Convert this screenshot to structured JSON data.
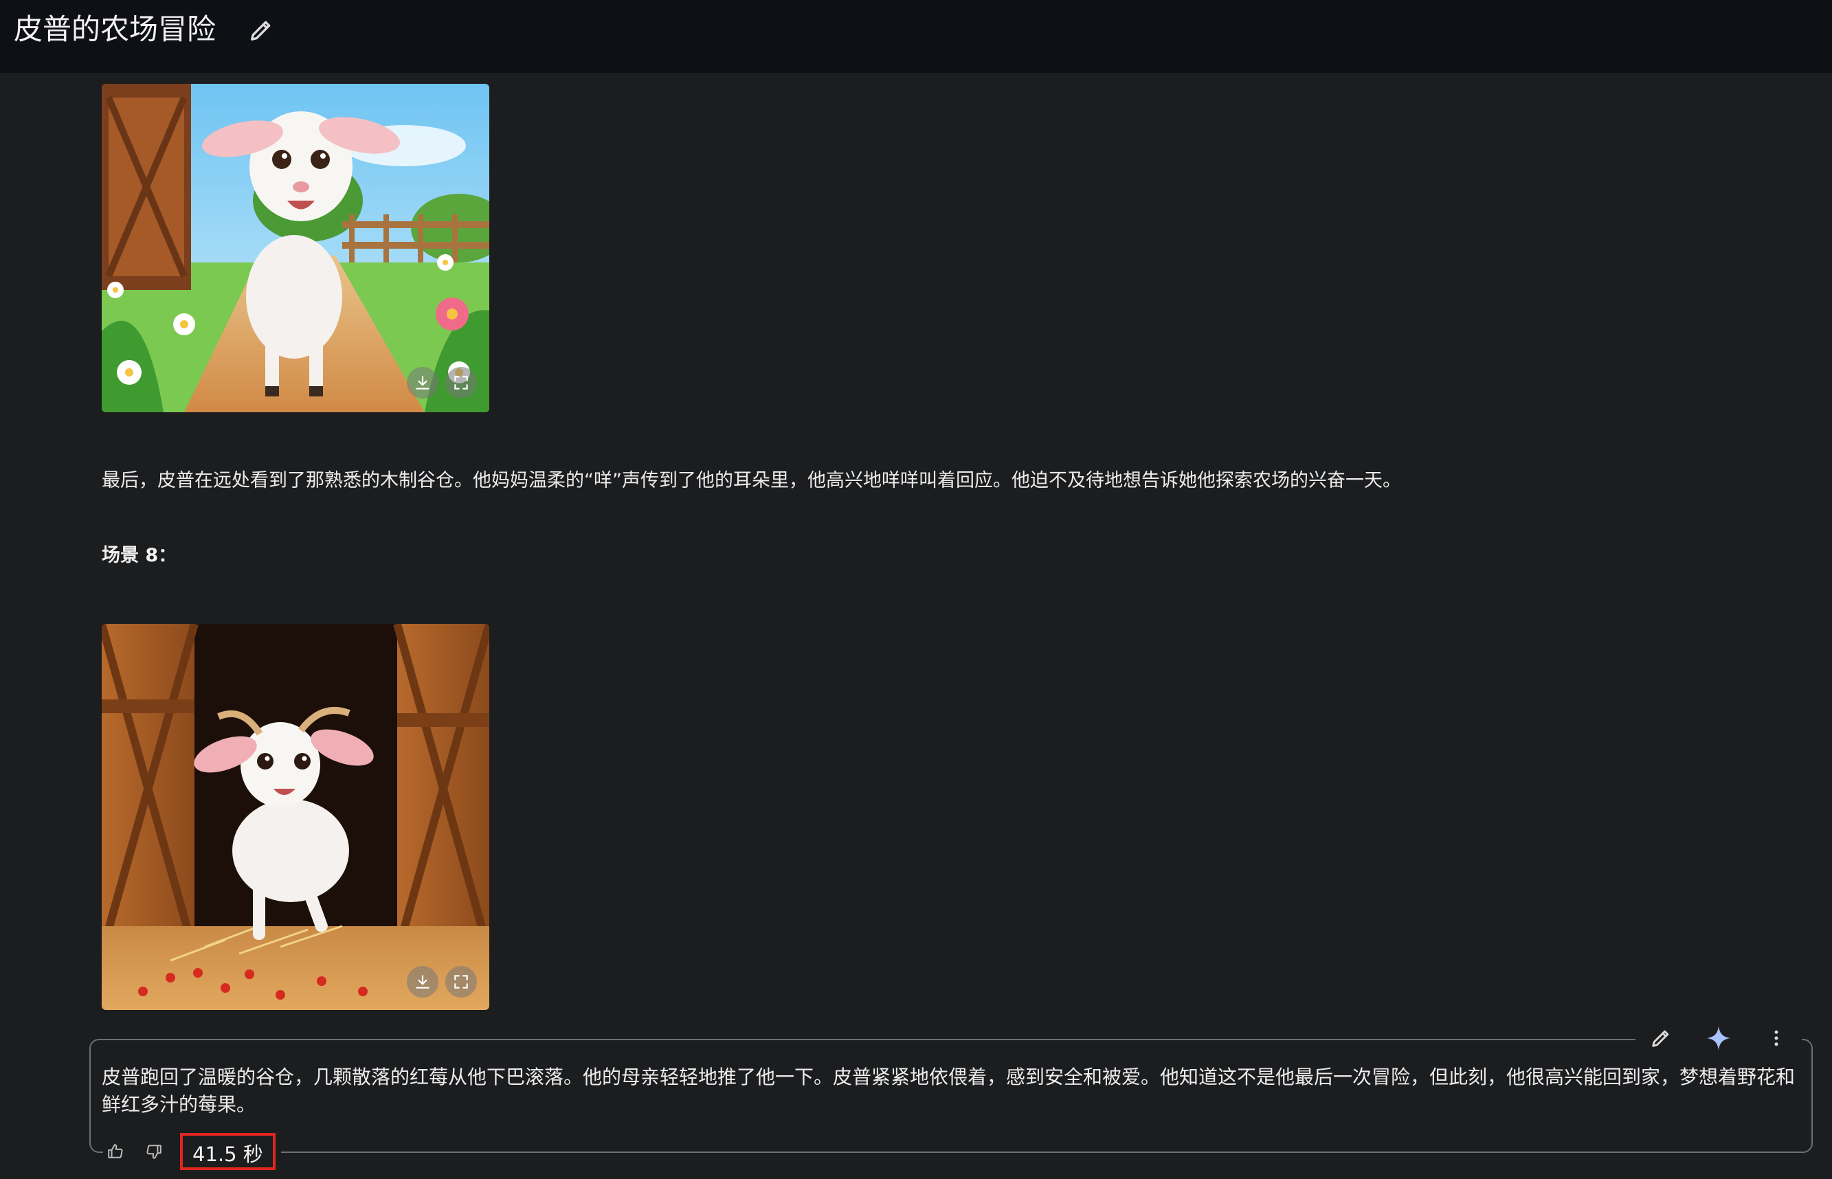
{
  "header": {
    "title": "皮普的农场冒险"
  },
  "content": {
    "image1": {
      "alt": ""
    },
    "paragraph1": "最后，皮普在远处看到了那熟悉的木制谷仓。他妈妈温柔的“咩”声传到了他的耳朵里，他高兴地咩咩叫着回应。他迫不及待地想告诉她他探索农场的兴奋一天。",
    "scene_heading": "场景 8：",
    "paragraph2": "皮普跑回了温暖的谷仓，几颗散落的红莓从他下巴滚落。他的母亲轻轻地推了他一下。皮普紧紧地依偎着，感到安全和被爱。他知道这不是他最后一次冒险，但此刻，他很高兴能回到家，梦想着野花和鲜红多汁的莓果。"
  },
  "response": {
    "elapsed": "41.5 秒"
  },
  "icons": {
    "edit": "pencil-icon",
    "sparkle": "sparkle-icon",
    "more": "more-vertical-icon",
    "download": "download-icon",
    "fullscreen": "fullscreen-icon",
    "like": "thumbs-up-icon",
    "dislike": "thumbs-down-icon"
  },
  "colors": {
    "background": "#1c1d1f",
    "topbar": "#0e1015",
    "highlight_border": "#e0261e",
    "sparkle": "#a8c1ff"
  }
}
